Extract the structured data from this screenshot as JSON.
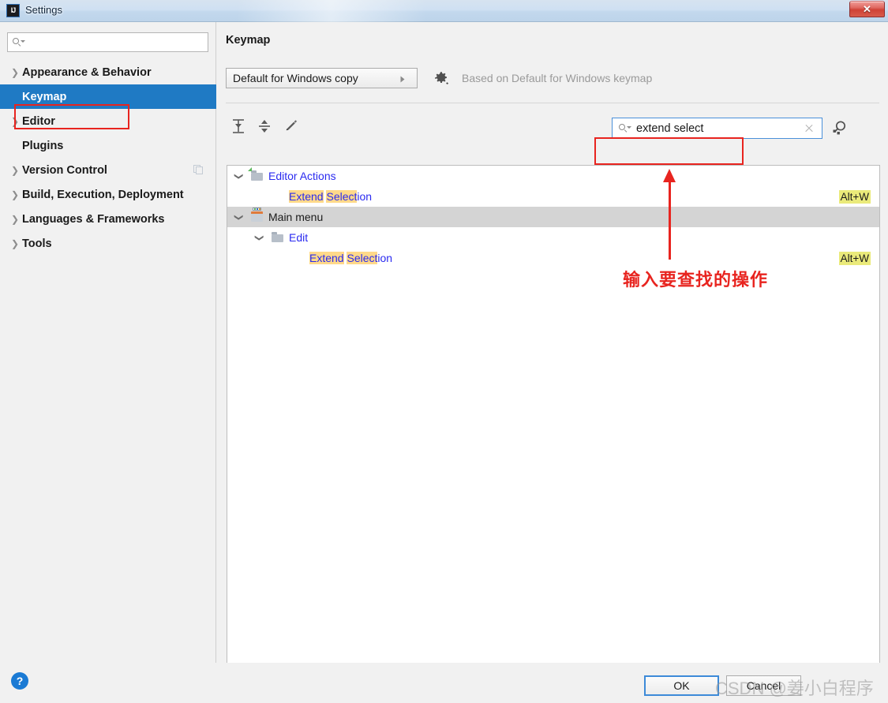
{
  "window": {
    "title": "Settings",
    "app_icon": "IJ",
    "close_label": "✕"
  },
  "sidebar": {
    "search_placeholder": "",
    "search_icon": "search-icon",
    "items": [
      {
        "label": "Appearance & Behavior",
        "expandable": true,
        "selected": false,
        "trailing_icon": ""
      },
      {
        "label": "Keymap",
        "expandable": false,
        "selected": true,
        "trailing_icon": ""
      },
      {
        "label": "Editor",
        "expandable": true,
        "selected": false,
        "trailing_icon": ""
      },
      {
        "label": "Plugins",
        "expandable": false,
        "selected": false,
        "trailing_icon": ""
      },
      {
        "label": "Version Control",
        "expandable": true,
        "selected": false,
        "trailing_icon": "copy-icon"
      },
      {
        "label": "Build, Execution, Deployment",
        "expandable": true,
        "selected": false,
        "trailing_icon": ""
      },
      {
        "label": "Languages & Frameworks",
        "expandable": true,
        "selected": false,
        "trailing_icon": ""
      },
      {
        "label": "Tools",
        "expandable": true,
        "selected": false,
        "trailing_icon": ""
      }
    ]
  },
  "main": {
    "panel_title": "Keymap",
    "keymap_select_value": "Default for Windows copy",
    "gear_icon": "gear-icon",
    "based_on_text": "Based on Default for Windows keymap",
    "toolbar": {
      "expand_all_tooltip": "Expand All",
      "collapse_all_tooltip": "Collapse All",
      "edit_tooltip": "Edit Shortcut"
    },
    "search": {
      "value": "extend select",
      "placeholder": "",
      "clear_label": "×",
      "find_by_shortcut_icon": "shortcut-search-icon"
    },
    "tree": [
      {
        "id": "editor-actions",
        "label": "Editor Actions",
        "depth": 0,
        "expanded": true,
        "icon": "folder-green-icon",
        "color": "blue",
        "selected": false,
        "shortcut": ""
      },
      {
        "id": "extend-selection-1",
        "label": "Extend Selection",
        "label_parts": [
          {
            "text": "Extend",
            "match": true
          },
          {
            "text": " ",
            "match": false
          },
          {
            "text": "Select",
            "match": true
          },
          {
            "text": "ion",
            "match": false
          }
        ],
        "depth": 2,
        "expanded": null,
        "icon": "",
        "color": "blue",
        "selected": false,
        "shortcut": "Alt+W"
      },
      {
        "id": "main-menu",
        "label": "Main menu",
        "depth": 0,
        "expanded": true,
        "icon": "folder-menu-icon",
        "color": "black",
        "selected": true,
        "shortcut": ""
      },
      {
        "id": "edit",
        "label": "Edit",
        "depth": 1,
        "expanded": true,
        "icon": "folder-icon",
        "color": "blue",
        "selected": false,
        "shortcut": ""
      },
      {
        "id": "extend-selection-2",
        "label": "Extend Selection",
        "label_parts": [
          {
            "text": "Extend",
            "match": true
          },
          {
            "text": " ",
            "match": false
          },
          {
            "text": "Select",
            "match": true
          },
          {
            "text": "ion",
            "match": false
          }
        ],
        "depth": 3,
        "expanded": null,
        "icon": "",
        "color": "blue",
        "selected": false,
        "shortcut": "Alt+W"
      }
    ]
  },
  "annotation": {
    "text": "输入要查找的操作",
    "color": "#e8241f"
  },
  "footer": {
    "help_label": "?",
    "ok_label": "OK",
    "cancel_label": "Cancel",
    "watermark": "CSDN @姜小白程序"
  },
  "colors": {
    "accent_selected": "#1f7ac4",
    "annotation_red": "#e8241f",
    "match_highlight": "#ffd98a",
    "shortcut_highlight": "#eaea7a",
    "tree_selected_row": "#d4d4d4",
    "node_blue": "#2a2af0"
  }
}
